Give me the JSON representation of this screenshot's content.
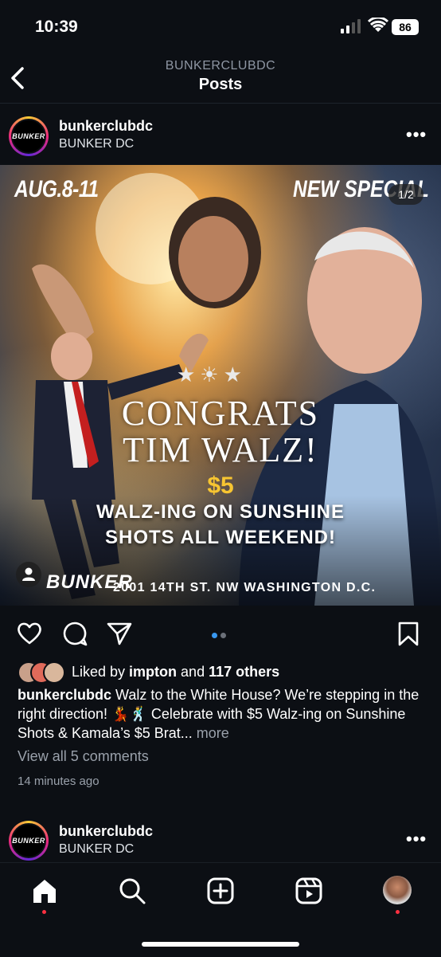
{
  "status": {
    "time": "10:39",
    "battery": "86"
  },
  "header": {
    "username": "BUNKERCLUBDC",
    "title": "Posts"
  },
  "post": {
    "username": "bunkerclubdc",
    "subtitle": "BUNKER DC",
    "avatar_text": "BUNKER",
    "menu": "•••",
    "image": {
      "counter": "1/2",
      "date": "AUG.8-11",
      "special": "NEW SPECIAL",
      "stars": "★☀★",
      "line1": "CONGRATS",
      "line2": "TIM WALZ!",
      "price": "$5",
      "promo1": "WALZ-ING ON SUNSHINE",
      "promo2": "SHOTS ALL WEEKEND!",
      "logo": "BUNKER",
      "address": "2001 14TH ST. NW WASHINGTON D.C."
    },
    "liked_by_prefix": "Liked by ",
    "liked_by_user": "impton",
    "liked_by_mid": " and ",
    "liked_by_count": "117 others",
    "caption_user": "bunkerclubdc",
    "caption_text": " Walz to the White House? We’re stepping in the right direction! 💃🕺 Celebrate with $5 Walz-ing on Sunshine Shots & Kamala’s $5 Brat...",
    "caption_more": " more",
    "view_comments": "View all 5 comments",
    "time_ago": "14 minutes ago"
  },
  "next_post": {
    "username": "bunkerclubdc",
    "subtitle": "BUNKER DC",
    "avatar_text": "BUNKER",
    "menu": "•••"
  },
  "colors": {
    "background": "#0c0f14",
    "accent_blue": "#3897f0",
    "notification_red": "#ff3040",
    "price_yellow": "#f7c531"
  }
}
